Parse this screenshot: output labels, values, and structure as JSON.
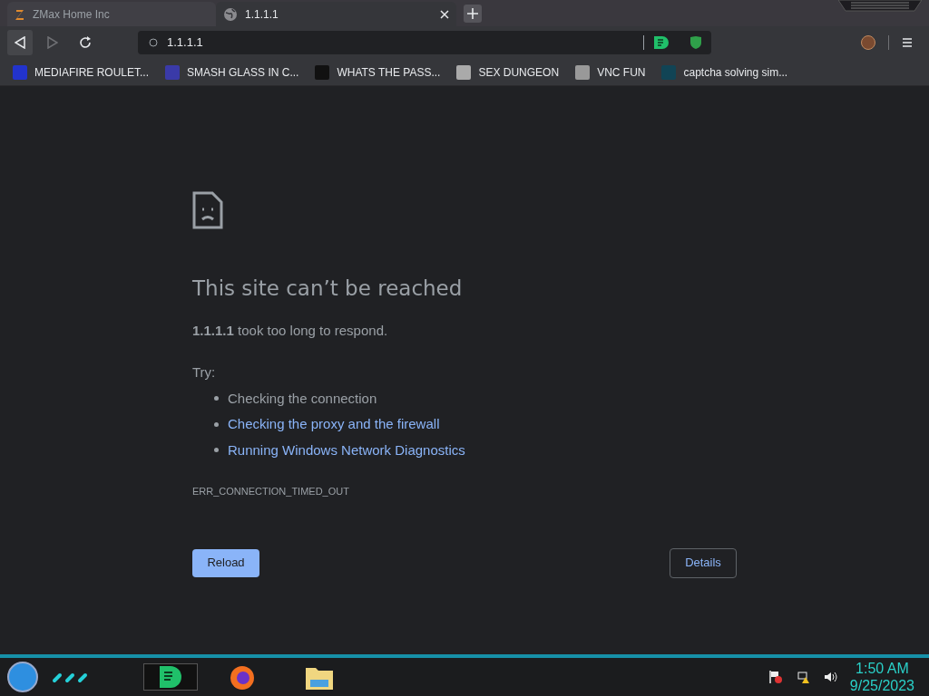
{
  "tabs": [
    {
      "title": "ZMax Home Inc",
      "selected": false
    },
    {
      "title": "1.1.1.1",
      "selected": true
    }
  ],
  "toolbar": {
    "back_disabled": false,
    "forward_disabled": true,
    "url": "1.1.1.1"
  },
  "bookmarks": [
    {
      "title": "MEDIAFIRE ROULET..."
    },
    {
      "title": "SMASH GLASS IN C..."
    },
    {
      "title": "WHATS THE PASS..."
    },
    {
      "title": "SEX DUNGEON"
    },
    {
      "title": "VNC FUN"
    },
    {
      "title": "captcha solving sim..."
    }
  ],
  "error": {
    "heading": "This site can’t be reached",
    "detail": "**1.1.1.1** took too long to respond.",
    "try_label": "Try:",
    "suggestions": [
      {
        "text": "Checking the connection",
        "kind": "text"
      },
      {
        "text": "Checking the proxy and the firewall",
        "kind": "link"
      },
      {
        "text": "Running Windows Network Diagnostics",
        "kind": "link"
      }
    ],
    "code": "ERR_CONNECTION_TIMED_OUT",
    "reload": "Reload",
    "details": "Details"
  },
  "taskbar": {
    "time": "1:50 AM",
    "date": "9/25/2023"
  }
}
